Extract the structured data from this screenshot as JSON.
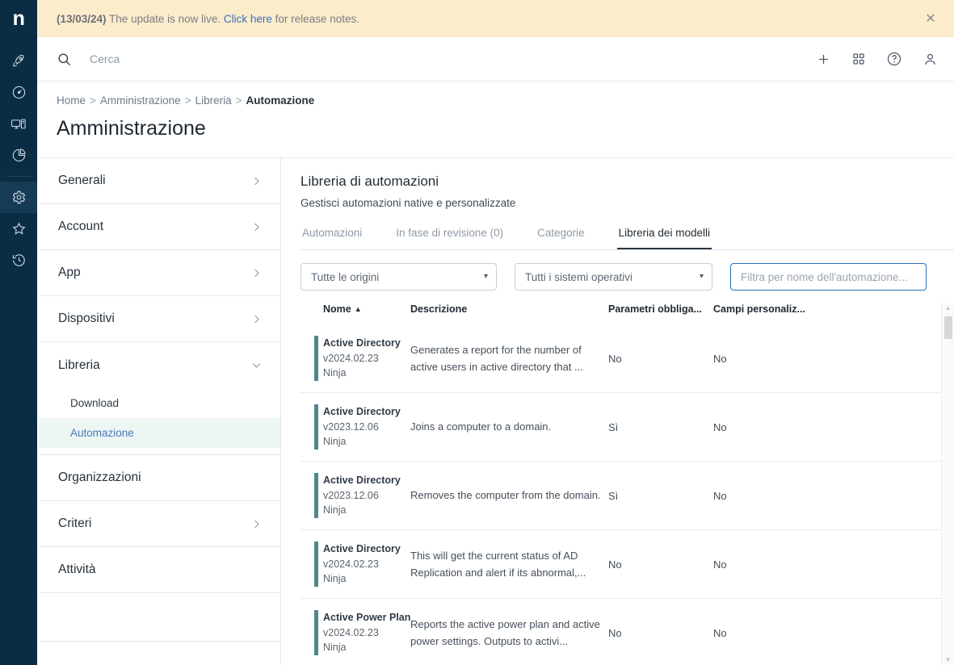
{
  "rail": {
    "logo": "n",
    "icons": [
      {
        "name": "rocket-icon",
        "label": "Lancio"
      },
      {
        "name": "gauge-icon",
        "label": "Dashboard"
      },
      {
        "name": "monitor-icon",
        "label": "Dispositivi"
      },
      {
        "name": "pie-chart-icon",
        "label": "Report"
      },
      {
        "name": "gear-icon",
        "label": "Amministrazione",
        "active": true
      },
      {
        "name": "star-icon",
        "label": "Preferiti"
      },
      {
        "name": "history-icon",
        "label": "Cronologia"
      }
    ]
  },
  "banner": {
    "date": "(13/03/24)",
    "text_before": " The update is now live. ",
    "link": "Click here",
    "text_after": " for release notes.",
    "close_glyph": "✕",
    "background": "#fbeccc",
    "link_color": "#3a6fbf"
  },
  "topbar": {
    "search_placeholder": "Cerca",
    "search_value": "",
    "actions": [
      {
        "name": "add-icon",
        "label": "Aggiungi"
      },
      {
        "name": "apps-grid-icon",
        "label": "App"
      },
      {
        "name": "help-icon",
        "label": "Aiuto"
      },
      {
        "name": "user-account-icon",
        "label": "Account"
      }
    ]
  },
  "breadcrumb": {
    "separator": ">",
    "items": [
      "Home",
      "Amministrazione",
      "Libreria",
      "Automazione"
    ]
  },
  "page_title": "Amministrazione",
  "settings_menu": {
    "items": [
      {
        "label": "Generali",
        "chevron": "right"
      },
      {
        "label": "Account",
        "chevron": "right"
      },
      {
        "label": "App",
        "chevron": "right"
      },
      {
        "label": "Dispositivi",
        "chevron": "right"
      },
      {
        "label": "Libreria",
        "chevron": "down"
      }
    ],
    "sub_items": [
      {
        "label": "Download",
        "active": false
      },
      {
        "label": "Automazione",
        "active": true
      }
    ],
    "items_after": [
      {
        "label": "Organizzazioni",
        "chevron": "none"
      },
      {
        "label": "Criteri",
        "chevron": "right"
      },
      {
        "label": "Attività",
        "chevron": "none"
      }
    ],
    "active_background": "#edf6f3"
  },
  "main": {
    "title": "Libreria di automazioni",
    "subtitle": "Gestisci automazioni native e personalizzate",
    "tabs": [
      {
        "label": "Automazioni",
        "active": false
      },
      {
        "label": "In fase di revisione (0)",
        "active": false
      },
      {
        "label": "Categorie",
        "active": false
      },
      {
        "label": "Libreria dei modelli",
        "active": true
      }
    ],
    "filters": {
      "source_select": {
        "value": "Tutte le origini",
        "caret": "▾"
      },
      "os_select": {
        "value": "Tutti i sistemi operativi",
        "caret": "▾"
      },
      "name_filter": {
        "value": "",
        "placeholder": "Filtra per nome dell'automazione...",
        "focused": true,
        "focus_color": "#2a6ebb"
      }
    },
    "table": {
      "accent_color": "#4f878d",
      "columns": [
        {
          "key": "name",
          "label": "Nome",
          "sorted": "asc",
          "sort_glyph": "▲"
        },
        {
          "key": "description",
          "label": "Descrizione"
        },
        {
          "key": "required_params",
          "label": "Parametri obbliga..."
        },
        {
          "key": "custom_fields",
          "label": "Campi personaliz..."
        }
      ],
      "rows": [
        {
          "name": "Active Directory",
          "version": "v2024.02.23",
          "source": "Ninja",
          "description": "Generates a report for the number of active users in active directory that ...",
          "required_params": "No",
          "custom_fields": "No"
        },
        {
          "name": "Active Directory",
          "version": "v2023.12.06",
          "source": "Ninja",
          "description": "Joins a computer to a domain.",
          "required_params": "Sì",
          "custom_fields": "No"
        },
        {
          "name": "Active Directory",
          "version": "v2023.12.06",
          "source": "Ninja",
          "description": "Removes the computer from the domain.",
          "required_params": "Sì",
          "custom_fields": "No"
        },
        {
          "name": "Active Directory",
          "version": "v2024.02.23",
          "source": "Ninja",
          "description": "This will get the current status of AD Replication and alert if its abnormal,...",
          "required_params": "No",
          "custom_fields": "No"
        },
        {
          "name": "Active Power Plan",
          "version": "v2024.02.23",
          "source": "Ninja",
          "description": "Reports the active power plan and active power settings. Outputs to activi...",
          "required_params": "No",
          "custom_fields": "No"
        }
      ]
    },
    "scrollbar": {
      "up_glyph": "▲",
      "down_glyph": "▼"
    }
  }
}
